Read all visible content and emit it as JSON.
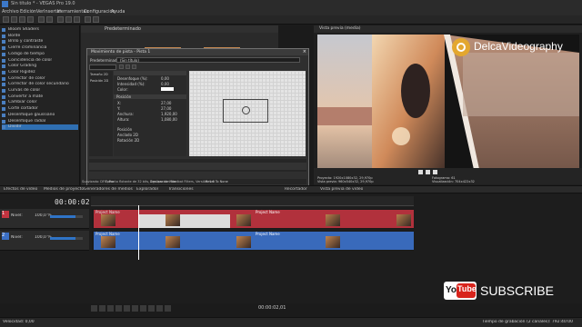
{
  "window": {
    "title": "Sin título * - VEGAS Pro 19.0"
  },
  "menu": [
    "Archivo",
    "Edición",
    "Ver",
    "Insertar",
    "Herramientas",
    "Configuración",
    "Ayuda"
  ],
  "presets_header": "Predeterminado",
  "effects_list": [
    "Bloom Shaders",
    "Borde",
    "Brillo y contraste",
    "Cierre crominancia",
    "Código de tiempo",
    "Coincidencia de color",
    "Color Grading",
    "Color Rigidez",
    "Corrector de color",
    "Corrector de color secundario",
    "Curvas de color",
    "Convertir a mate",
    "Cambiar color",
    "Corte cortador",
    "Desenfoque gaussiano",
    "Desenfoque radial",
    "Dividir"
  ],
  "effects_selected_index": 16,
  "dialog": {
    "title": "Movimiento de pista - Pista 1",
    "preset_label": "Predeterminado:",
    "preset_value": "(Sin título)",
    "props_col": [
      "Tamaño 2D",
      "Posición 2D"
    ],
    "props": [
      {
        "label": "Desenfoque (%):",
        "value": "0,00"
      },
      {
        "label": "Intensidad (%):",
        "value": "0,00"
      },
      {
        "label": "Color:",
        "value": ""
      }
    ],
    "position_header": "Posición",
    "position": [
      {
        "label": "X:",
        "value": "27,00"
      },
      {
        "label": "Y:",
        "value": "27,00"
      },
      {
        "label": "Anchura:",
        "value": "1,920,00"
      },
      {
        "label": "Altura:",
        "value": "1,080,00"
      }
    ],
    "origin": [
      "Posición",
      "Anclado 2D",
      "Rotación 2D"
    ],
    "bottom_tabs": [
      "Fotos",
      "Deslizar con film",
      "Reset To None"
    ]
  },
  "preview": {
    "title": "Vista previa (media)",
    "brand": "DelcaVideography",
    "info": [
      "Proyecto: 1920x1080x32, 29,970p",
      "Vista previa: 960x540x32, 29,970p",
      "Pantalla: 384x216x32"
    ],
    "info_right": [
      "Fotograma: 61",
      "Visualización: 704x422x32"
    ],
    "timecode": "00:00:02,01"
  },
  "effect_desc": "Suavizado: DFG, Punto flotante de 32 bits, Agrupación Noodbat Filters, Versión: 1.0",
  "tabs": [
    "Efectos de vídeo",
    "Medios de proyecto",
    "Generadores de medios",
    "Explorador",
    "Transiciones",
    "Recortador",
    "Vista previa de vídeo"
  ],
  "timeline": {
    "timecode": "00:00:02,01",
    "tracks": [
      {
        "num": "1",
        "label": "Nivel:",
        "value": "100,0 %",
        "color": "#c23440",
        "clip_name": "Project Name"
      },
      {
        "num": "2",
        "label": "Nivel:",
        "value": "100,0 %",
        "color": "#3b6fc4",
        "clip_name": "Project Name"
      }
    ],
    "transport_timecode": "00:00:02,01",
    "rate": "Velocidad: 0,00"
  },
  "subscribe": {
    "yt_text": "You",
    "yt_tube": "Tube",
    "label": "SUBSCRIBE"
  },
  "status": {
    "left": "Velocidad: 0,00",
    "right": "Tiempo de grabación (2 canales): 792:40:00"
  },
  "colors": {
    "accent": "#2f74c7",
    "track_red": "#c23440",
    "track_blue": "#3b6fc4",
    "logo": "#e3a72f"
  }
}
